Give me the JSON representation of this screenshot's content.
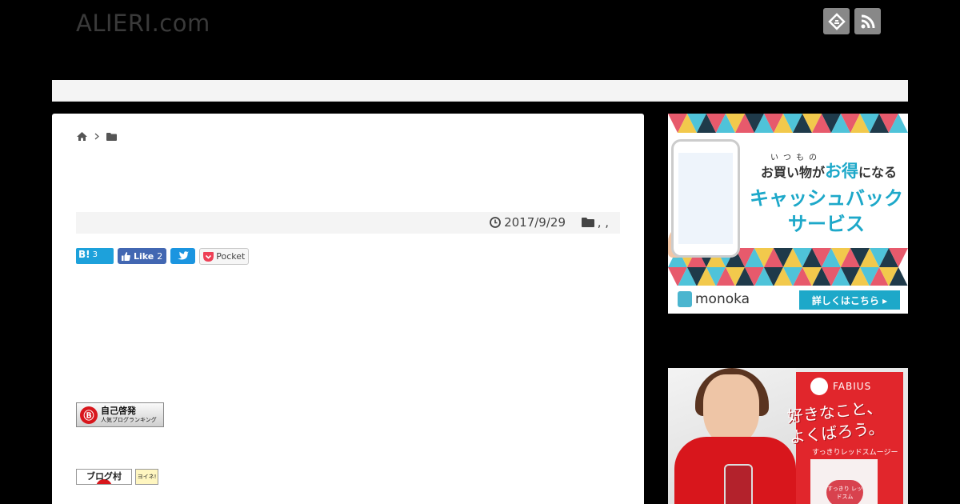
{
  "header": {
    "site_title": "ALIERI.com",
    "icons": [
      "feedly-icon",
      "rss-icon"
    ]
  },
  "post": {
    "date": "2017/9/29",
    "categories": ", ,"
  },
  "share": {
    "hatena": {
      "label": "B!",
      "count": "3"
    },
    "facebook": {
      "label": "Like",
      "count": "2"
    },
    "pocket": {
      "label": "Pocket"
    }
  },
  "ranking_banner": {
    "mark": "Ⓑ",
    "title": "自己啓発",
    "subtitle": "人気ブログランキング"
  },
  "blog_village": {
    "label": "ブログ村",
    "badge": "ヨイネ!"
  },
  "ad_monoka": {
    "small": "いつもの",
    "line1_a": "お買い物が",
    "line1_b": "お得",
    "line1_c": "になる",
    "line2": "キャッシュバック",
    "line3": "サービス",
    "logo": "monoka",
    "cta": "詳しくはこちら ▸"
  },
  "ad_fabius": {
    "brand": "FABIUS",
    "headline1": "好きなこと、",
    "headline2": "よくばろう。",
    "product": "すっきりレッドスムージー",
    "package": "すっきり レッドスム"
  },
  "colors": {
    "background": "#000000",
    "accent_blue": "#1da8c9",
    "fabius_red": "#e1262c"
  }
}
